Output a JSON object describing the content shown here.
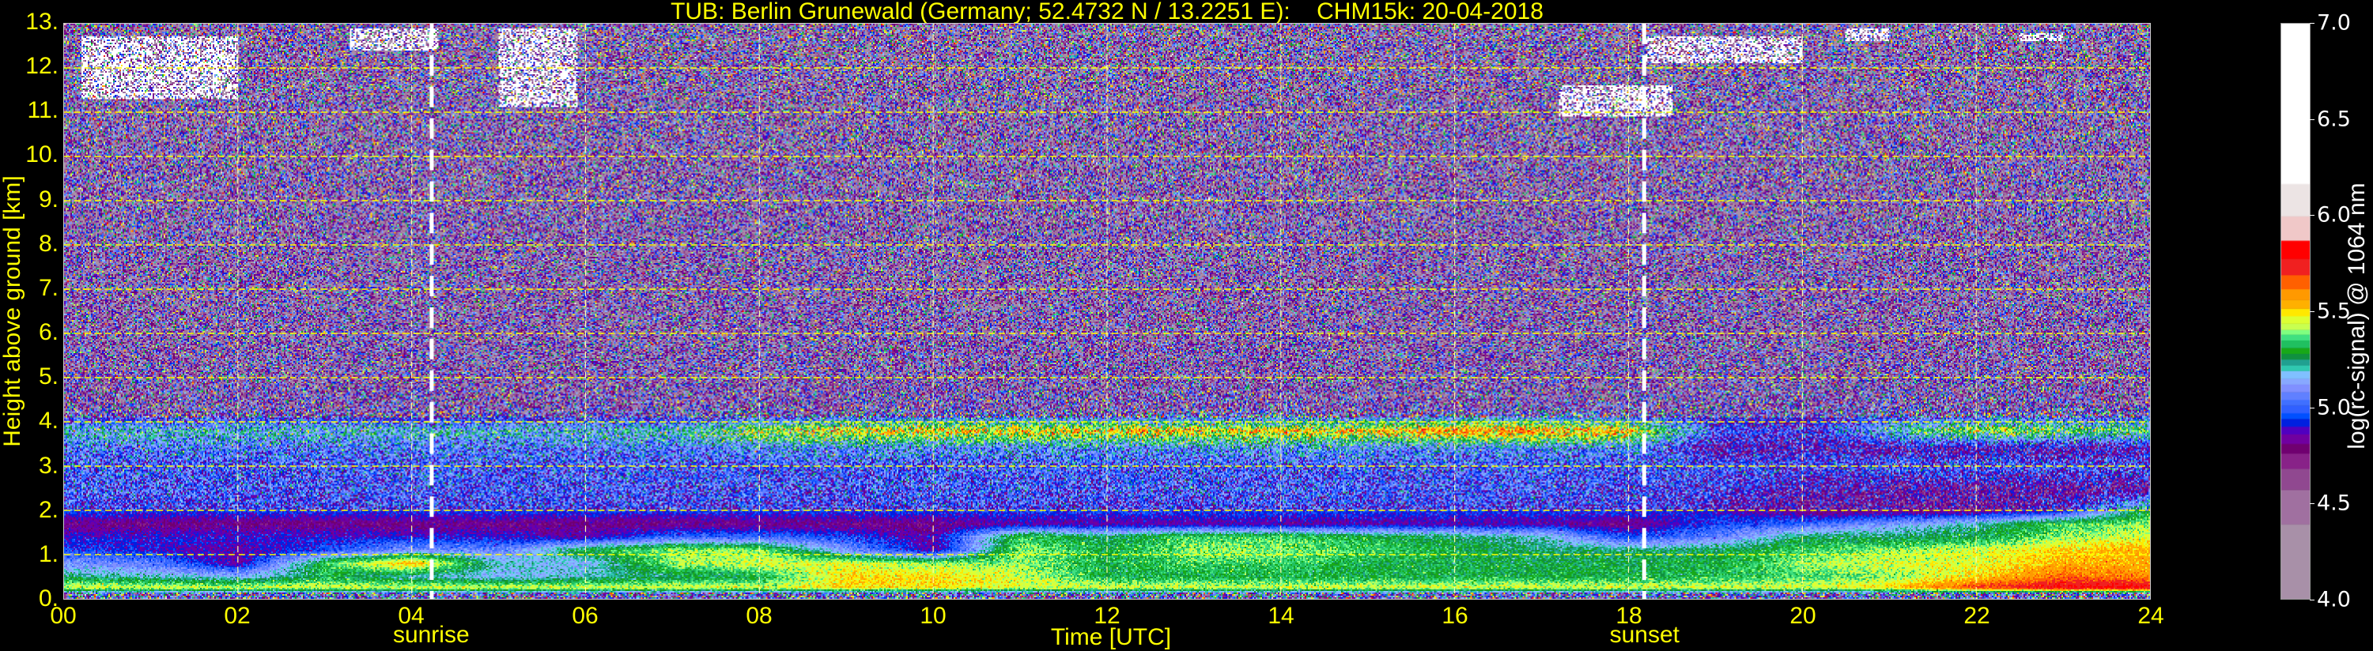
{
  "chart_data": {
    "type": "heatmap",
    "title": "TUB: Berlin Grunewald (Germany; 52.4732 N / 13.2251 E):    CHM15k: 20-04-2018",
    "xlabel": "Time [UTC]",
    "ylabel": "Height above ground [km]",
    "colorbar_label": "log(rc-signal) @ 1064 nm",
    "xlim": [
      0,
      24
    ],
    "ylim": [
      0,
      13
    ],
    "clim": [
      4.0,
      7.0
    ],
    "grid": true,
    "x_ticks": [
      "00",
      "02",
      "04",
      "06",
      "08",
      "10",
      "12",
      "14",
      "16",
      "18",
      "20",
      "22",
      "24"
    ],
    "x_tick_values": [
      0,
      2,
      4,
      6,
      8,
      10,
      12,
      14,
      16,
      18,
      20,
      22,
      24
    ],
    "y_ticks": [
      "0.",
      "1.",
      "2.",
      "3.",
      "4.",
      "5.",
      "6.",
      "7.",
      "8.",
      "9.",
      "10.",
      "11.",
      "12.",
      "13."
    ],
    "y_tick_values": [
      0,
      1,
      2,
      3,
      4,
      5,
      6,
      7,
      8,
      9,
      10,
      11,
      12,
      13
    ],
    "colorbar_ticks": [
      "4.0",
      "4.5",
      "5.0",
      "5.5",
      "6.0",
      "6.5",
      "7.0"
    ],
    "colorbar_tick_values": [
      4.0,
      4.5,
      5.0,
      5.5,
      6.0,
      6.5,
      7.0
    ],
    "annotations": [
      {
        "label": "sunrise",
        "time": 4.23
      },
      {
        "label": "sunset",
        "time": 18.18
      }
    ],
    "colormap": [
      {
        "upto": 4.39,
        "color": "#a890a8"
      },
      {
        "upto": 4.57,
        "color": "#a070a0"
      },
      {
        "upto": 4.68,
        "color": "#904890"
      },
      {
        "upto": 4.76,
        "color": "#882288"
      },
      {
        "upto": 4.81,
        "color": "#700070"
      },
      {
        "upto": 4.86,
        "color": "#7000a0"
      },
      {
        "upto": 4.9,
        "color": "#5000c0"
      },
      {
        "upto": 4.94,
        "color": "#0020e0"
      },
      {
        "upto": 4.97,
        "color": "#0050ff"
      },
      {
        "upto": 5.01,
        "color": "#3060ff"
      },
      {
        "upto": 5.04,
        "color": "#4070ff"
      },
      {
        "upto": 5.08,
        "color": "#6080ff"
      },
      {
        "upto": 5.12,
        "color": "#8090ff"
      },
      {
        "upto": 5.15,
        "color": "#88a8ff"
      },
      {
        "upto": 5.19,
        "color": "#80c0ff"
      },
      {
        "upto": 5.22,
        "color": "#30c8b0"
      },
      {
        "upto": 5.25,
        "color": "#20a090"
      },
      {
        "upto": 5.28,
        "color": "#109040"
      },
      {
        "upto": 5.31,
        "color": "#18a818"
      },
      {
        "upto": 5.35,
        "color": "#20c060"
      },
      {
        "upto": 5.38,
        "color": "#40e080"
      },
      {
        "upto": 5.405,
        "color": "#80ff80"
      },
      {
        "upto": 5.437,
        "color": "#c8ff50"
      },
      {
        "upto": 5.476,
        "color": "#ddff33"
      },
      {
        "upto": 5.515,
        "color": "#ffe800"
      },
      {
        "upto": 5.56,
        "color": "#ffb000"
      },
      {
        "upto": 5.617,
        "color": "#ff9900"
      },
      {
        "upto": 5.69,
        "color": "#ff6000"
      },
      {
        "upto": 5.775,
        "color": "#f02020"
      },
      {
        "upto": 5.87,
        "color": "#ff0000"
      },
      {
        "upto": 5.997,
        "color": "#f0c8c8"
      },
      {
        "upto": 6.166,
        "color": "#ece4e4"
      },
      {
        "upto": 7.0,
        "color": "#ffffff"
      }
    ],
    "times": [
      0,
      1,
      2,
      3,
      4,
      5,
      6,
      7,
      8,
      9,
      10,
      11,
      12,
      13,
      14,
      15,
      16,
      17,
      18,
      19,
      20,
      21,
      22,
      23,
      24
    ],
    "heights": [
      0.1,
      0.25,
      0.5,
      0.8,
      1.1,
      1.4,
      1.7,
      2.0,
      2.5,
      3.0,
      3.4,
      3.8,
      4.3,
      6,
      9,
      13
    ],
    "z": [
      [
        5.0,
        5.0,
        5.0,
        5.0,
        5.0,
        5.0,
        5.0,
        5.0,
        5.0,
        5.0,
        5.0,
        5.0,
        5.0,
        5.0,
        5.0,
        5.0,
        5.0,
        5.0,
        5.0,
        5.0,
        5.0,
        5.0,
        5.0,
        5.0,
        5.0
      ],
      [
        5.45,
        5.45,
        5.45,
        5.45,
        5.45,
        5.45,
        5.45,
        5.45,
        5.45,
        5.5,
        5.5,
        5.45,
        5.45,
        5.45,
        5.45,
        5.45,
        5.45,
        5.45,
        5.45,
        5.45,
        5.45,
        5.5,
        5.7,
        5.8,
        5.8
      ],
      [
        5.25,
        5.2,
        5.15,
        5.3,
        5.2,
        5.15,
        5.2,
        5.25,
        5.3,
        5.5,
        5.5,
        5.45,
        5.3,
        5.3,
        5.3,
        5.3,
        5.3,
        5.3,
        5.3,
        5.32,
        5.35,
        5.4,
        5.5,
        5.65,
        5.6
      ],
      [
        5.1,
        5.05,
        4.85,
        5.35,
        5.55,
        5.2,
        5.15,
        5.4,
        5.45,
        5.45,
        5.4,
        5.4,
        5.3,
        5.35,
        5.35,
        5.3,
        5.3,
        5.28,
        5.28,
        5.3,
        5.4,
        5.45,
        5.45,
        5.55,
        5.55
      ],
      [
        4.95,
        4.9,
        4.85,
        4.95,
        5.1,
        5.05,
        5.3,
        5.4,
        5.4,
        5.1,
        4.85,
        5.4,
        5.3,
        5.4,
        5.4,
        5.35,
        5.3,
        5.25,
        5.25,
        5.25,
        5.35,
        5.4,
        5.45,
        5.5,
        5.55
      ],
      [
        4.9,
        4.9,
        4.9,
        4.9,
        4.9,
        4.9,
        4.85,
        5.0,
        5.0,
        4.95,
        4.85,
        5.35,
        5.25,
        5.35,
        5.35,
        5.3,
        5.25,
        5.2,
        4.95,
        5.05,
        5.25,
        5.25,
        5.28,
        5.4,
        5.45
      ],
      [
        4.8,
        4.8,
        4.8,
        4.8,
        4.8,
        4.8,
        4.8,
        4.8,
        4.8,
        4.8,
        4.8,
        4.85,
        4.85,
        4.85,
        4.85,
        4.85,
        4.85,
        4.85,
        4.8,
        4.95,
        5.0,
        5.1,
        5.2,
        5.35,
        5.4
      ],
      [
        4.95,
        4.95,
        4.95,
        4.95,
        4.95,
        4.95,
        4.95,
        4.95,
        4.95,
        4.95,
        4.95,
        4.95,
        4.95,
        4.95,
        4.95,
        4.95,
        4.95,
        4.95,
        4.95,
        4.9,
        4.8,
        4.8,
        4.8,
        4.9,
        5.3
      ],
      [
        5.0,
        5.0,
        5.0,
        5.0,
        5.0,
        5.0,
        5.0,
        5.0,
        5.0,
        5.0,
        5.0,
        5.0,
        5.0,
        5.0,
        5.0,
        5.0,
        5.0,
        5.0,
        4.97,
        4.95,
        4.85,
        4.82,
        4.8,
        4.8,
        4.8
      ],
      [
        5.0,
        5.0,
        5.0,
        5.0,
        5.0,
        5.0,
        5.0,
        5.0,
        5.0,
        5.0,
        5.0,
        5.0,
        5.0,
        5.0,
        5.0,
        5.0,
        5.0,
        5.0,
        5.0,
        5.0,
        5.0,
        5.0,
        5.0,
        5.0,
        5.0
      ],
      [
        5.05,
        5.05,
        5.05,
        5.05,
        5.05,
        5.05,
        5.05,
        5.05,
        5.1,
        5.1,
        5.1,
        5.1,
        5.1,
        5.1,
        5.1,
        5.1,
        5.1,
        5.1,
        5.1,
        4.85,
        4.85,
        4.85,
        4.85,
        4.85,
        4.85
      ],
      [
        5.2,
        5.2,
        5.2,
        5.2,
        5.2,
        5.2,
        5.2,
        5.2,
        5.4,
        5.5,
        5.5,
        5.5,
        5.5,
        5.5,
        5.5,
        5.5,
        5.6,
        5.6,
        5.5,
        5.0,
        4.9,
        5.2,
        5.4,
        5.35,
        5.3
      ],
      [
        4.75,
        4.75,
        4.75,
        4.75,
        4.75,
        4.75,
        4.75,
        4.75,
        4.75,
        4.75,
        4.75,
        4.75,
        4.75,
        4.75,
        4.75,
        4.75,
        4.75,
        4.75,
        4.75,
        4.8,
        4.8,
        4.8,
        4.8,
        4.8,
        4.8
      ],
      [
        4.7,
        4.7,
        4.7,
        4.7,
        4.7,
        4.7,
        4.7,
        4.7,
        4.7,
        4.7,
        4.7,
        4.7,
        4.7,
        4.7,
        4.7,
        4.7,
        4.7,
        4.7,
        4.7,
        4.7,
        4.7,
        4.7,
        4.7,
        4.7,
        4.7
      ],
      [
        4.7,
        4.7,
        4.7,
        4.7,
        4.7,
        4.7,
        4.7,
        4.7,
        4.7,
        4.7,
        4.7,
        4.7,
        4.7,
        4.7,
        4.7,
        4.7,
        4.7,
        4.7,
        4.7,
        4.7,
        4.7,
        4.7,
        4.7,
        4.7,
        4.7
      ],
      [
        4.75,
        4.75,
        4.75,
        4.75,
        4.75,
        4.75,
        4.75,
        4.75,
        4.75,
        4.75,
        4.75,
        4.75,
        4.75,
        4.75,
        4.75,
        4.75,
        4.75,
        4.75,
        4.75,
        4.75,
        4.75,
        4.75,
        4.75,
        4.75,
        4.75
      ]
    ],
    "clouds": [
      {
        "t": [
          0.2,
          2.0
        ],
        "h": [
          11.3,
          12.7
        ],
        "value": 6.6
      },
      {
        "t": [
          3.3,
          4.3
        ],
        "h": [
          12.4,
          12.9
        ],
        "value": 6.6
      },
      {
        "t": [
          5.0,
          5.9
        ],
        "h": [
          11.1,
          12.9
        ],
        "value": 6.4
      },
      {
        "t": [
          17.2,
          18.5
        ],
        "h": [
          10.9,
          11.6
        ],
        "value": 6.6
      },
      {
        "t": [
          18.2,
          20.0
        ],
        "h": [
          12.1,
          12.7
        ],
        "value": 6.6
      },
      {
        "t": [
          20.5,
          21.0
        ],
        "h": [
          12.6,
          12.9
        ],
        "value": 6.3
      },
      {
        "t": [
          22.5,
          23.0
        ],
        "h": [
          12.6,
          12.8
        ],
        "value": 6.3
      }
    ]
  }
}
